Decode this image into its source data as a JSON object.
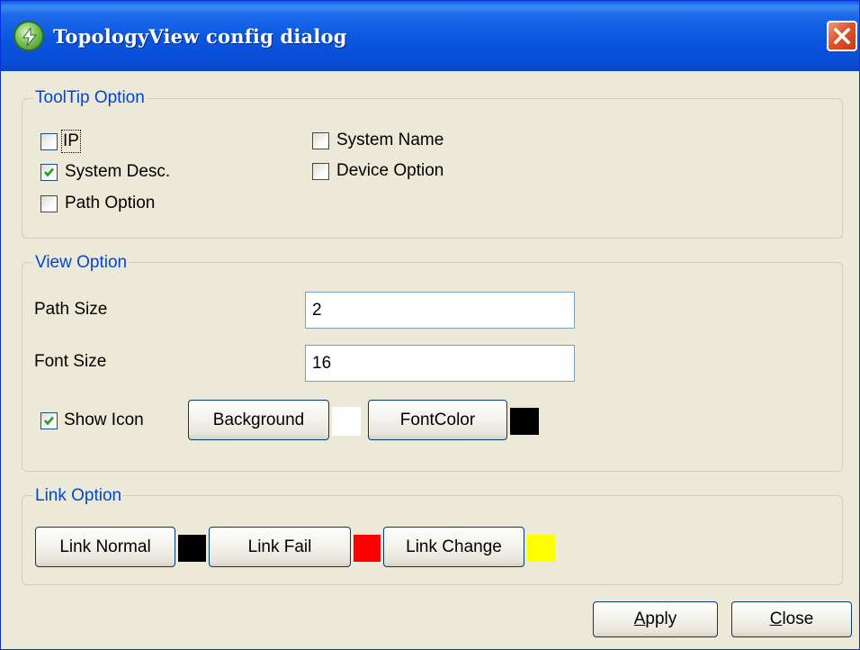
{
  "window": {
    "title": "TopologyView config dialog"
  },
  "tooltip_option": {
    "legend": "ToolTip Option",
    "items": [
      {
        "label": "IP",
        "checked": false
      },
      {
        "label": "System Name",
        "checked": false
      },
      {
        "label": "System Desc.",
        "checked": true
      },
      {
        "label": "Device Option",
        "checked": false
      },
      {
        "label": "Path Option",
        "checked": false
      }
    ]
  },
  "view_option": {
    "legend": "View Option",
    "path_size_label": "Path Size",
    "path_size_value": "2",
    "font_size_label": "Font Size",
    "font_size_value": "16",
    "show_icon_label": "Show Icon",
    "show_icon_checked": true,
    "background_button": "Background",
    "background_color": "#ffffff",
    "fontcolor_button": "FontColor",
    "font_color": "#000000"
  },
  "link_option": {
    "legend": "Link Option",
    "link_normal_button": "Link Normal",
    "link_normal_color": "#000000",
    "link_fail_button": "Link Fail",
    "link_fail_color": "#ff0000",
    "link_change_button": "Link Change",
    "link_change_color": "#ffff00"
  },
  "footer": {
    "apply_button": "Apply",
    "close_button": "Close"
  },
  "icons": {
    "app": "app-icon",
    "close": "close-icon",
    "check": "check-icon"
  }
}
